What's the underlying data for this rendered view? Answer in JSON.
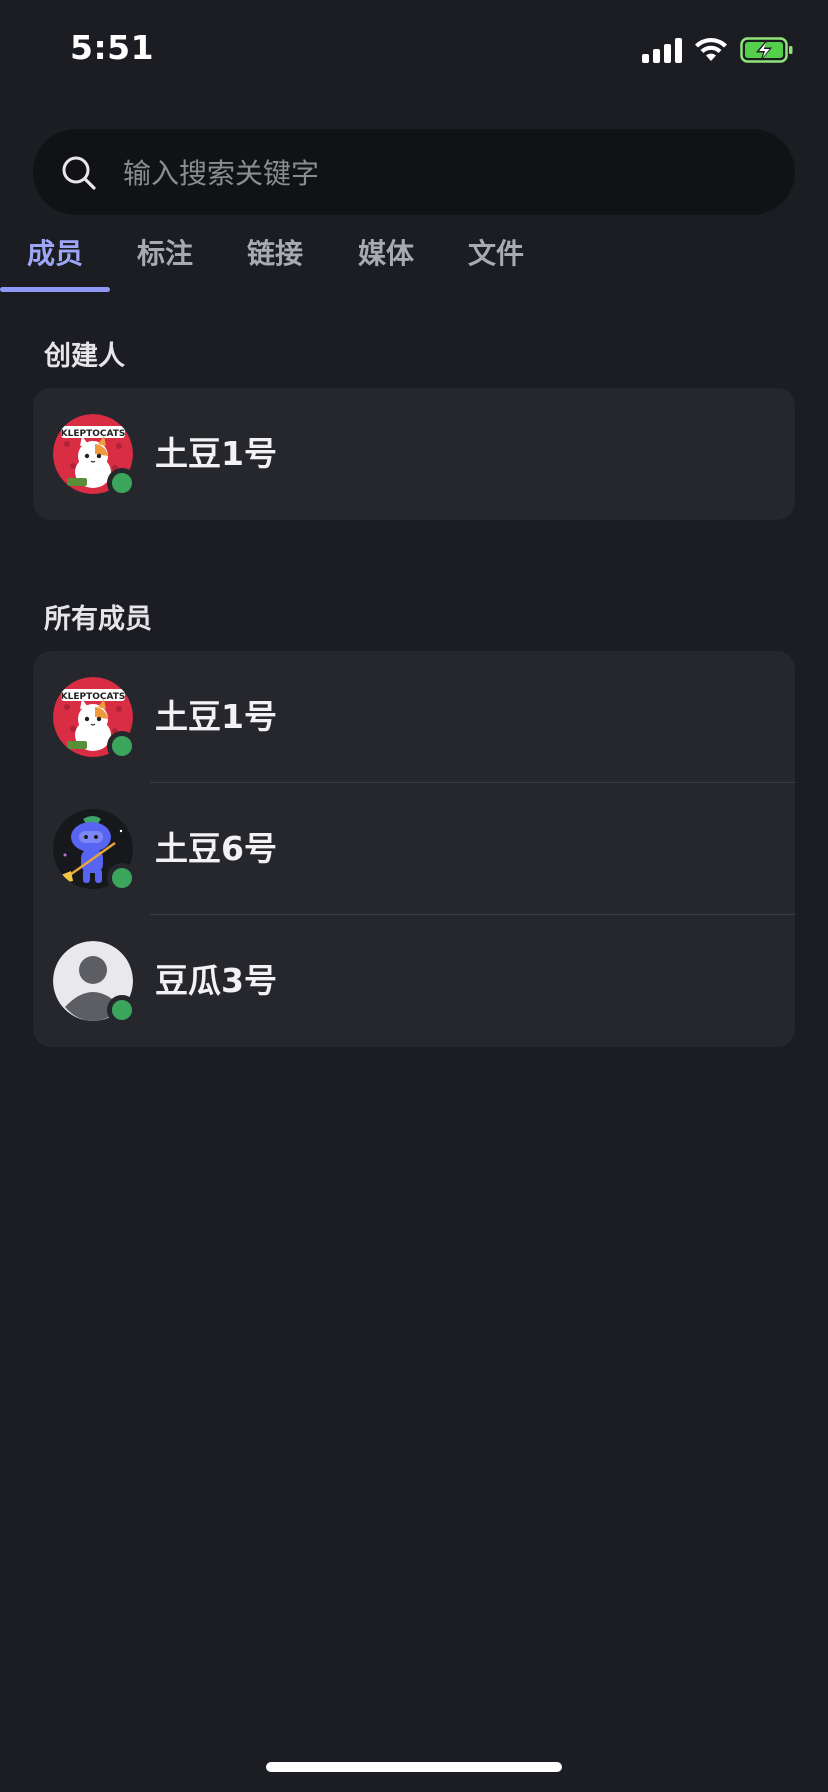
{
  "status_bar": {
    "time": "5:51"
  },
  "search": {
    "placeholder": "输入搜索关键字",
    "icon": "search-icon"
  },
  "tabs": [
    {
      "label": "成员",
      "active": true
    },
    {
      "label": "标注",
      "active": false
    },
    {
      "label": "链接",
      "active": false
    },
    {
      "label": "媒体",
      "active": false
    },
    {
      "label": "文件",
      "active": false
    }
  ],
  "creator_section": {
    "title": "创建人",
    "members": [
      {
        "name": "土豆1号",
        "avatar": "klepto-cats-avatar",
        "online": true
      }
    ]
  },
  "all_members_section": {
    "title": "所有成员",
    "members": [
      {
        "name": "土豆1号",
        "avatar": "klepto-cats-avatar",
        "online": true
      },
      {
        "name": "土豆6号",
        "avatar": "blue-robot-avatar",
        "online": true
      },
      {
        "name": "豆瓜3号",
        "avatar": "default-person-avatar",
        "online": true
      }
    ]
  },
  "colors": {
    "background": "#1c1d22",
    "card": "#26272d",
    "accent": "#8f98f4",
    "online": "#3ba55c"
  }
}
